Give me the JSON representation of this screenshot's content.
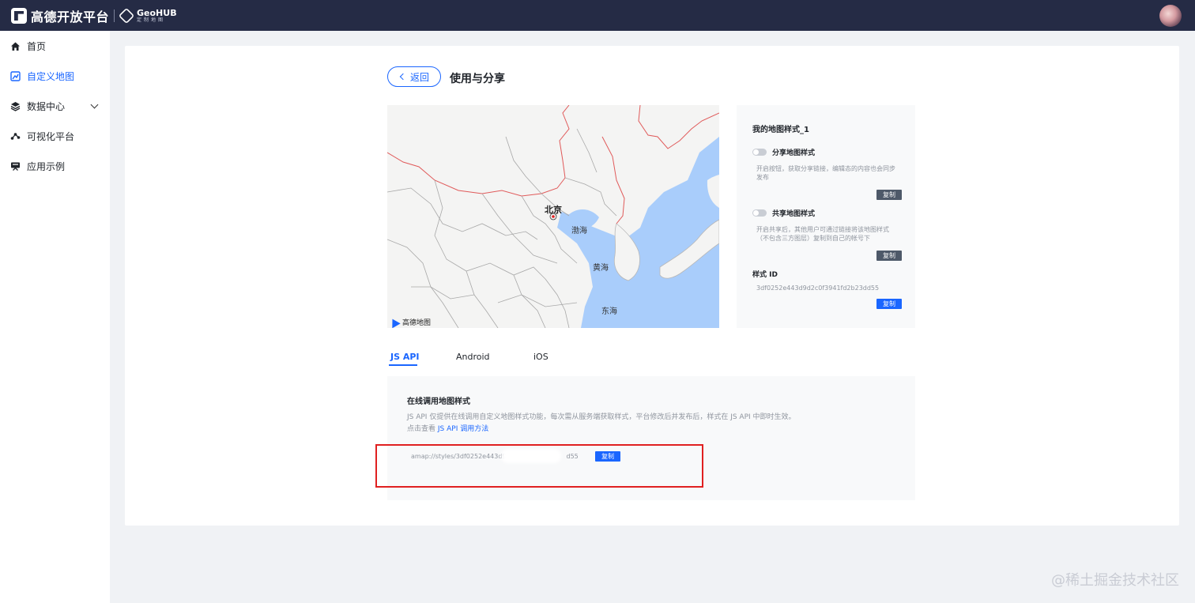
{
  "header": {
    "brand": "高德开放平台",
    "product_title": "GeoHUB",
    "product_sub": "定制地图"
  },
  "sidebar": {
    "items": [
      {
        "label": "首页",
        "icon": "home-icon"
      },
      {
        "label": "自定义地图",
        "icon": "custom-map-icon",
        "active": true
      },
      {
        "label": "数据中心",
        "icon": "layers-icon",
        "expandable": true
      },
      {
        "label": "可视化平台",
        "icon": "visualization-icon"
      },
      {
        "label": "应用示例",
        "icon": "examples-icon"
      }
    ]
  },
  "page": {
    "back_label": "返回",
    "title": "使用与分享"
  },
  "map": {
    "city": "北京",
    "labels": [
      "渤海",
      "黄海",
      "东海"
    ],
    "provider": "高德地图"
  },
  "panel": {
    "style_name": "我的地图样式_1",
    "share": {
      "label": "分享地图样式",
      "desc": "开启按钮，获取分享链接，编辑态的内容也会同步发布",
      "enabled": false
    },
    "collab": {
      "label": "共享地图样式",
      "desc": "开启共享后，其他用户可通过链接将该地图样式（不包含三方图层）复制到自己的帐号下",
      "enabled": false
    },
    "copy_label": "复制",
    "style_id_label": "样式 ID",
    "style_id": "3df0252e443d9d2c0f3941fd2b23dd55"
  },
  "tabs": [
    {
      "label": "JS API",
      "active": true
    },
    {
      "label": "Android"
    },
    {
      "label": "iOS"
    }
  ],
  "jsapi": {
    "title": "在线调用地图样式",
    "desc": "JS API 仅提供在线调用自定义地图样式功能，每次需从服务端获取样式，平台修改后并发布后，样式在 JS API 中即时生效。",
    "link_prefix": "点击查看",
    "link_text": "JS API 调用方法",
    "url_prefix": "amap://styles/3df0252e443d9",
    "url_suffix": "d55",
    "copy_label": "复制"
  },
  "watermark": "@稀土掘金技术社区",
  "colors": {
    "accent": "#1a66ff",
    "topbar": "#252b45",
    "highlight": "#e02020"
  }
}
